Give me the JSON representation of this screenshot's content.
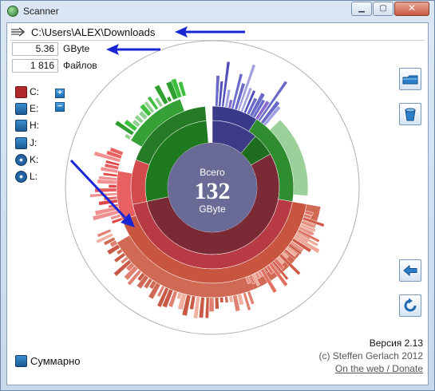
{
  "window": {
    "title": "Scanner"
  },
  "path": {
    "current": "C:\\Users\\ALEX\\Downloads"
  },
  "stats": {
    "size_value": "5.36",
    "size_unit": "GByte",
    "file_count": "1 816",
    "file_unit": "Файлов"
  },
  "drives": [
    {
      "label": "C:",
      "kind": "system-drive-icon"
    },
    {
      "label": "E:",
      "kind": "hard-drive-icon"
    },
    {
      "label": "H:",
      "kind": "hard-drive-icon"
    },
    {
      "label": "J:",
      "kind": "hard-drive-icon"
    },
    {
      "label": "K:",
      "kind": "cd-drive-icon"
    },
    {
      "label": "L:",
      "kind": "cd-drive-icon"
    }
  ],
  "summary_label": "Суммарно",
  "center": {
    "caption": "Всего",
    "value": "132",
    "unit": "GByte"
  },
  "credits": {
    "version": "Версия 2.13",
    "author": "(c) Steffen Gerlach 2012",
    "link": "On the web / Donate"
  },
  "colors": {
    "accent": "#1a25d6",
    "center": "#6a6a96",
    "red_family": "#cc4a4a",
    "green_family": "#2f8f2f",
    "blue_family": "#4a4aa8"
  }
}
